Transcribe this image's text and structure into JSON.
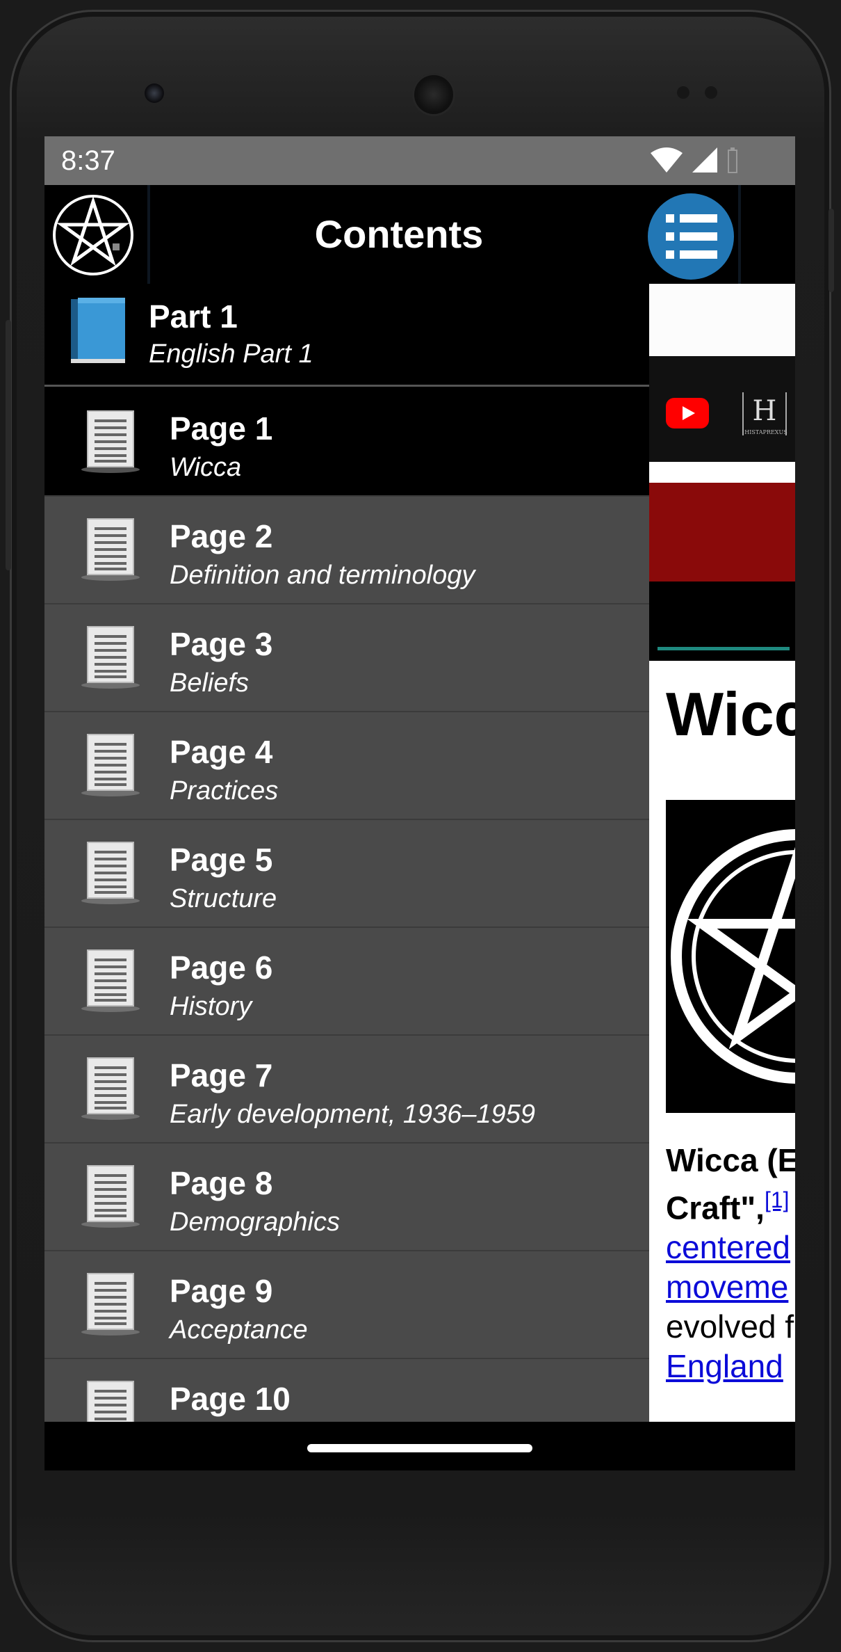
{
  "status_bar": {
    "time": "8:37"
  },
  "drawer": {
    "title": "Contents",
    "part": {
      "title": "Part 1",
      "subtitle": "English Part 1"
    },
    "pages": [
      {
        "title": "Page 1",
        "subtitle": "Wicca",
        "selected": true
      },
      {
        "title": "Page 2",
        "subtitle": "Definition and terminology"
      },
      {
        "title": "Page 3",
        "subtitle": "Beliefs"
      },
      {
        "title": "Page 4",
        "subtitle": "Practices"
      },
      {
        "title": "Page 5",
        "subtitle": "Structure"
      },
      {
        "title": "Page 6",
        "subtitle": "History"
      },
      {
        "title": "Page 7",
        "subtitle": "Early development, 1936–1959"
      },
      {
        "title": "Page 8",
        "subtitle": "Demographics"
      },
      {
        "title": "Page 9",
        "subtitle": "Acceptance"
      },
      {
        "title": "Page 10",
        "subtitle": ""
      }
    ]
  },
  "article": {
    "title": "Wicc",
    "lines": [
      "Wicca (E",
      "Craft\",",
      "[1]",
      "centered",
      "moveme",
      "evolved f",
      "England"
    ],
    "youtube_icon": "youtube-icon",
    "channel_logo_text": "H",
    "channel_logo_caption": "HISTAPREXUS"
  },
  "colors": {
    "status_bar": "#6f6f6f",
    "drawer_row": "#4a4a4a",
    "selected_row": "#000000",
    "menu_button": "#2277b5",
    "article_banner": "#8a0a0a",
    "link": "#0b0bd8"
  }
}
